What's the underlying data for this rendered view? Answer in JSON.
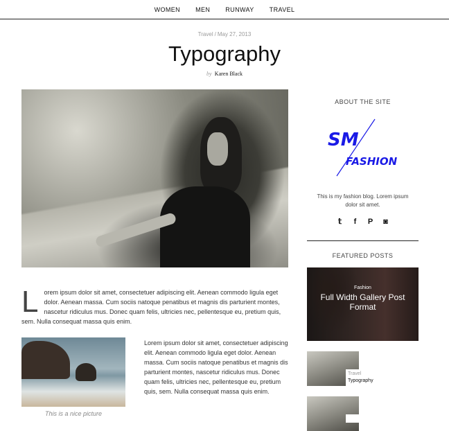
{
  "nav": {
    "items": [
      {
        "label": "WOMEN"
      },
      {
        "label": "MEN"
      },
      {
        "label": "RUNWAY"
      },
      {
        "label": "TRAVEL"
      }
    ]
  },
  "post": {
    "category": "Travel",
    "separator": "/",
    "date": "May 27, 2013",
    "title": "Typography",
    "by_label": "by",
    "author": "Karen Black",
    "dropcap": "L",
    "paragraph1": "orem ipsum dolor sit amet, consectetuer adipiscing elit. Aenean commodo ligula eget dolor. Aenean massa. Cum sociis natoque penatibus et magnis dis parturient montes, nascetur ridiculus mus. Donec quam felis, ultricies nec, pellentesque eu, pretium quis, sem. Nulla consequat massa quis enim.",
    "paragraph2": "Lorem ipsum dolor sit amet, consectetuer adipiscing elit. Aenean commodo ligula eget dolor. Aenean massa. Cum sociis natoque penatibus et magnis dis parturient montes, nascetur ridiculus mus. Donec quam felis, ultricies nec, pellentesque eu, pretium quis, sem. Nulla consequat massa quis enim.",
    "image_caption": "This is a nice picture"
  },
  "sidebar": {
    "about_heading": "ABOUT THE SITE",
    "logo_text_top": "SM",
    "logo_text_bottom": "FASHION",
    "about_text": "This is my fashion blog. Lorem ipsum dolor sit amet.",
    "social": [
      {
        "icon": "twitter-icon",
        "glyph": "𝕥"
      },
      {
        "icon": "facebook-icon",
        "glyph": "f"
      },
      {
        "icon": "pinterest-icon",
        "glyph": "P"
      },
      {
        "icon": "instagram-icon",
        "glyph": "◙"
      }
    ],
    "featured_heading": "FEATURED POSTS",
    "featured": {
      "category": "Fashion",
      "title": "Full Width Gallery Post Format"
    },
    "mini_posts": [
      {
        "category": "Travel",
        "title": "Typography"
      },
      {
        "category": "",
        "title": ""
      }
    ]
  },
  "colors": {
    "logo_blue": "#1a1ae6",
    "text": "#333333",
    "rule": "#222222"
  }
}
